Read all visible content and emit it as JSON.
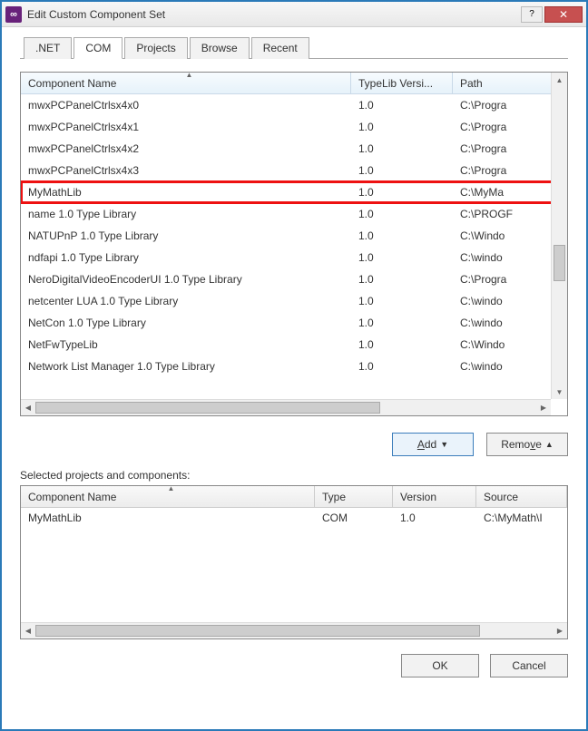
{
  "window": {
    "title": "Edit Custom Component Set"
  },
  "tabs": [
    {
      "label": ".NET"
    },
    {
      "label": "COM"
    },
    {
      "label": "Projects"
    },
    {
      "label": "Browse"
    },
    {
      "label": "Recent"
    }
  ],
  "active_tab_index": 1,
  "columns": {
    "name": "Component Name",
    "version": "TypeLib Versi...",
    "path": "Path"
  },
  "rows": [
    {
      "name": "mwxPCPanelCtrlsx4x0",
      "version": "1.0",
      "path": "C:\\Progra"
    },
    {
      "name": "mwxPCPanelCtrlsx4x1",
      "version": "1.0",
      "path": "C:\\Progra"
    },
    {
      "name": "mwxPCPanelCtrlsx4x2",
      "version": "1.0",
      "path": "C:\\Progra"
    },
    {
      "name": "mwxPCPanelCtrlsx4x3",
      "version": "1.0",
      "path": "C:\\Progra"
    },
    {
      "name": "MyMathLib",
      "version": "1.0",
      "path": "C:\\MyMa",
      "highlight": true
    },
    {
      "name": "name 1.0 Type Library",
      "version": "1.0",
      "path": "C:\\PROGF"
    },
    {
      "name": "NATUPnP 1.0 Type Library",
      "version": "1.0",
      "path": "C:\\Windo"
    },
    {
      "name": "ndfapi 1.0 Type Library",
      "version": "1.0",
      "path": "C:\\windo"
    },
    {
      "name": "NeroDigitalVideoEncoderUI 1.0 Type Library",
      "version": "1.0",
      "path": "C:\\Progra"
    },
    {
      "name": "netcenter LUA 1.0 Type Library",
      "version": "1.0",
      "path": "C:\\windo"
    },
    {
      "name": "NetCon 1.0 Type Library",
      "version": "1.0",
      "path": "C:\\windo"
    },
    {
      "name": "NetFwTypeLib",
      "version": "1.0",
      "path": "C:\\Windo"
    },
    {
      "name": "Network List Manager 1.0 Type Library",
      "version": "1.0",
      "path": "C:\\windo"
    }
  ],
  "buttons": {
    "add": "Add",
    "remove": "Remove",
    "ok": "OK",
    "cancel": "Cancel"
  },
  "selected_label": "Selected projects and components:",
  "selected_columns": {
    "name": "Component Name",
    "type": "Type",
    "version": "Version",
    "source": "Source"
  },
  "selected_rows": [
    {
      "name": "MyMathLib",
      "type": "COM",
      "version": "1.0",
      "source": "C:\\MyMath\\I"
    }
  ]
}
